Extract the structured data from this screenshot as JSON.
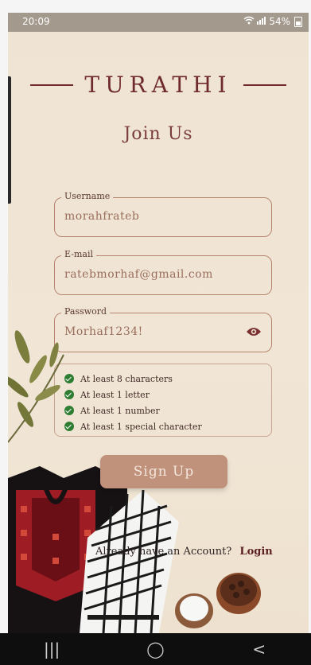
{
  "status": {
    "time": "20:09",
    "battery": "54%",
    "icons": [
      "wifi-icon",
      "signal-icon",
      "battery-icon"
    ]
  },
  "brand": {
    "name": "TURATHI",
    "color": "#6e2a2d"
  },
  "page": {
    "title": "Join Us"
  },
  "form": {
    "username": {
      "label": "Username",
      "value": "morahfrateb"
    },
    "email": {
      "label": "E-mail",
      "value": "ratebmorhaf@gmail.com"
    },
    "password": {
      "label": "Password",
      "value": "Morhaf1234!"
    }
  },
  "password_rules": [
    {
      "text": "At least 8 characters",
      "met": true
    },
    {
      "text": "At least 1 letter",
      "met": true
    },
    {
      "text": "At least 1 number",
      "met": true
    },
    {
      "text": "At least 1 special character",
      "met": true
    }
  ],
  "actions": {
    "signup": "Sign Up",
    "have_account": "Already have an Account?",
    "login": "Login"
  },
  "navbar": {
    "recent": "|||",
    "home": "◯",
    "back": "<"
  },
  "colors": {
    "accent": "#c0917b",
    "check": "#2e7d32",
    "background": "#efe3d3"
  }
}
